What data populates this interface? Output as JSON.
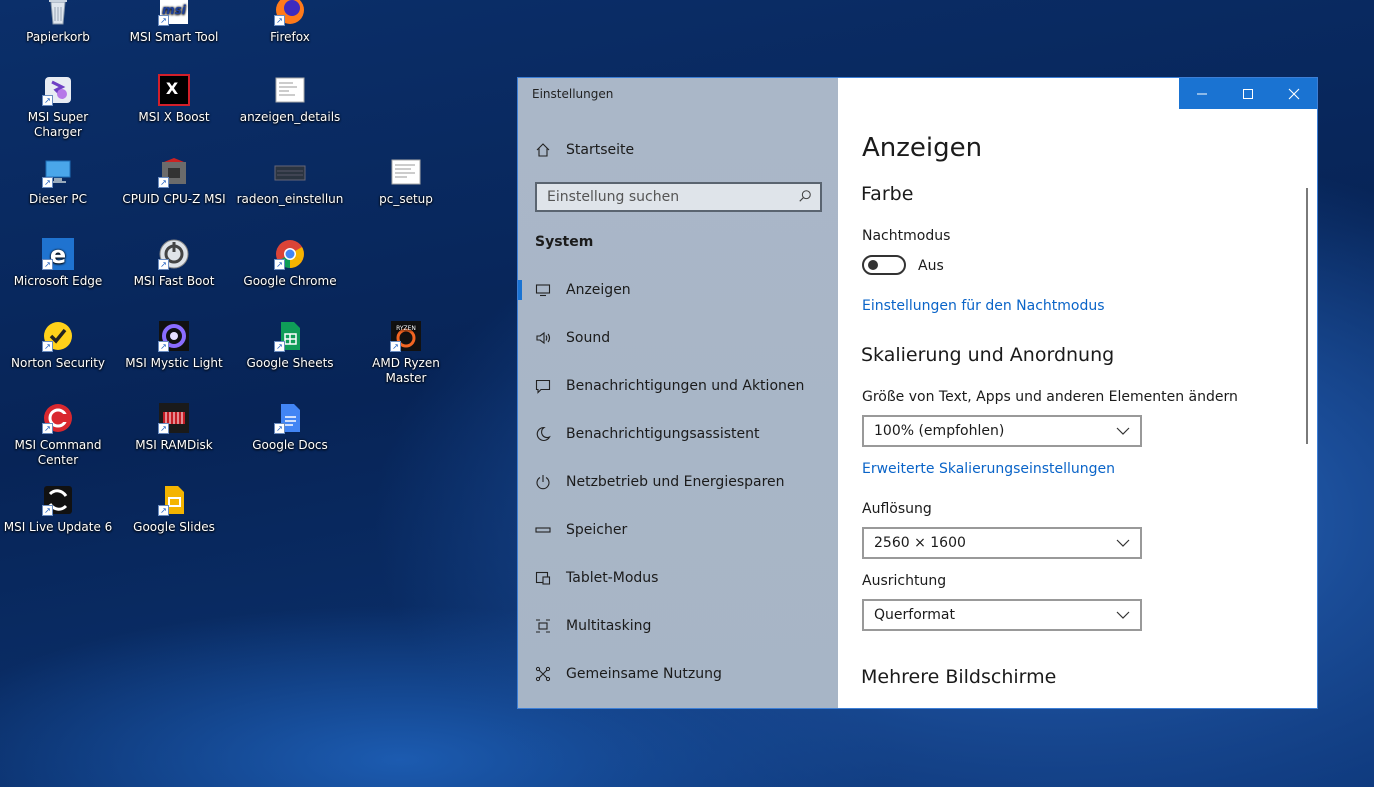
{
  "desktop": {
    "icons": [
      {
        "label": "Papierkorb",
        "icon": "recycle-bin-icon"
      },
      {
        "label": "MSI Smart Tool",
        "icon": "msi-icon"
      },
      {
        "label": "Firefox",
        "icon": "firefox-icon"
      },
      {
        "label": "MSI Super Charger",
        "icon": "msi-super-charger-icon"
      },
      {
        "label": "MSI X Boost",
        "icon": "msi-x-boost-icon"
      },
      {
        "label": "anzeigen_details",
        "icon": "document-icon"
      },
      {
        "label": "Dieser PC",
        "icon": "computer-icon"
      },
      {
        "label": "CPUID CPU-Z MSI",
        "icon": "cpuz-icon"
      },
      {
        "label": "radeon_einstellun",
        "icon": "image-file-icon"
      },
      {
        "label": "pc_setup",
        "icon": "document-icon"
      },
      {
        "label": "Microsoft Edge",
        "icon": "edge-icon"
      },
      {
        "label": "MSI Fast Boot",
        "icon": "msi-fast-boot-icon"
      },
      {
        "label": "Google Chrome",
        "icon": "chrome-icon"
      },
      {
        "label": "Norton Security",
        "icon": "norton-icon"
      },
      {
        "label": "MSI Mystic Light",
        "icon": "mystic-light-icon"
      },
      {
        "label": "Google Sheets",
        "icon": "google-sheets-icon"
      },
      {
        "label": "AMD Ryzen Master",
        "icon": "ryzen-icon"
      },
      {
        "label": "MSI Command Center",
        "icon": "msi-command-center-icon"
      },
      {
        "label": "MSI RAMDisk",
        "icon": "ramdisk-icon"
      },
      {
        "label": "Google Docs",
        "icon": "google-docs-icon"
      },
      {
        "label": "MSI Live Update 6",
        "icon": "live-update-icon"
      },
      {
        "label": "Google Slides",
        "icon": "google-slides-icon"
      }
    ]
  },
  "window": {
    "title": "Einstellungen",
    "controls": {
      "minimize": "minimize-icon",
      "maximize": "maximize-icon",
      "close": "close-icon"
    },
    "accent": "#1a73d2"
  },
  "sidebar": {
    "home_label": "Startseite",
    "search_placeholder": "Einstellung suchen",
    "section": "System",
    "items": [
      {
        "label": "Anzeigen",
        "icon": "monitor-icon",
        "active": true
      },
      {
        "label": "Sound",
        "icon": "speaker-icon"
      },
      {
        "label": "Benachrichtigungen und Aktionen",
        "icon": "notification-icon"
      },
      {
        "label": "Benachrichtigungsassistent",
        "icon": "moon-icon"
      },
      {
        "label": "Netzbetrieb und Energiesparen",
        "icon": "power-icon"
      },
      {
        "label": "Speicher",
        "icon": "storage-icon"
      },
      {
        "label": "Tablet-Modus",
        "icon": "tablet-icon"
      },
      {
        "label": "Multitasking",
        "icon": "multitasking-icon"
      },
      {
        "label": "Gemeinsame Nutzung",
        "icon": "share-icon"
      }
    ]
  },
  "content": {
    "title": "Anzeigen",
    "farbe": {
      "heading": "Farbe",
      "nachtmodus_label": "Nachtmodus",
      "toggle_state": "Aus",
      "toggle_on": false,
      "link": "Einstellungen für den Nachtmodus"
    },
    "skalierung": {
      "heading": "Skalierung und Anordnung",
      "size_label": "Größe von Text, Apps und anderen Elementen ändern",
      "size_value": "100% (empfohlen)",
      "advanced_link": "Erweiterte Skalierungseinstellungen",
      "resolution_label": "Auflösung",
      "resolution_value": "2560 × 1600",
      "orientation_label": "Ausrichtung",
      "orientation_value": "Querformat"
    },
    "mehrere": {
      "heading": "Mehrere Bildschirme"
    }
  }
}
